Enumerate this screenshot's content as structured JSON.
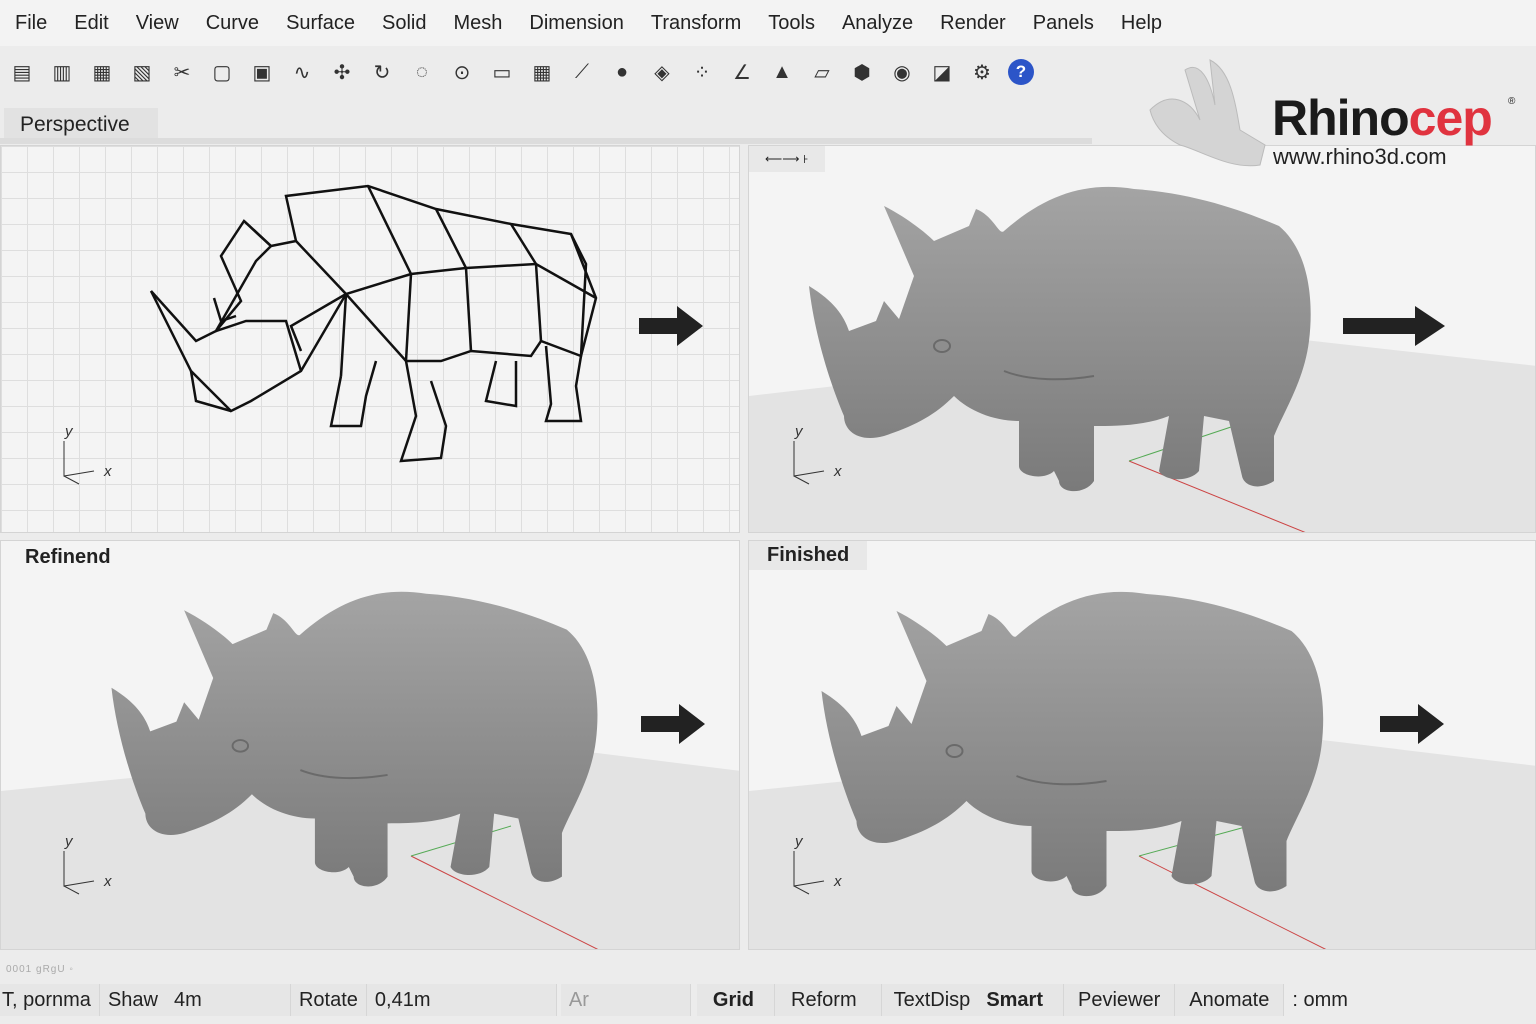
{
  "menu": [
    "File",
    "Edit",
    "View",
    "Curve",
    "Surface",
    "Solid",
    "Mesh",
    "Dimension",
    "Transform",
    "Tools",
    "Analyze",
    "Render",
    "Panels",
    "Help"
  ],
  "toolbar": {
    "icons": [
      "new-icon",
      "open-icon",
      "save-icon",
      "print-icon",
      "cut-icon",
      "copy-icon",
      "paste-icon",
      "curve-icon",
      "move-icon",
      "rotate-icon",
      "lasso-icon",
      "zoom-icon",
      "window-icon",
      "layout-icon",
      "line-icon",
      "sphere-icon",
      "shape-icon",
      "points-icon",
      "angle-icon",
      "cone-icon",
      "box-icon",
      "cylinder-icon",
      "material-icon",
      "render-icon",
      "settings-icon",
      "help-icon"
    ],
    "help_label": "?"
  },
  "logo": {
    "name_dark": "Rhino",
    "name_red": "cep",
    "reg": "®",
    "url": "www.rhino3d.com",
    "color_red": "#e0333f"
  },
  "viewports": {
    "perspective_tab": "Perspective",
    "top_right_tab": "⟵⟶ ꜔",
    "bottom_left_label": "Refinend",
    "bottom_right_label": "Finished",
    "axis_y": "y",
    "axis_x": "x"
  },
  "small_text": "0001 gRgU  ◦",
  "status": [
    "T, pornma",
    "Shaw",
    "4m",
    "Rotate",
    "0,41m",
    "Ar",
    "Grid",
    "Reform",
    "TextDisp",
    "Smart",
    "Peviewer",
    "Anomate",
    ": omm"
  ]
}
